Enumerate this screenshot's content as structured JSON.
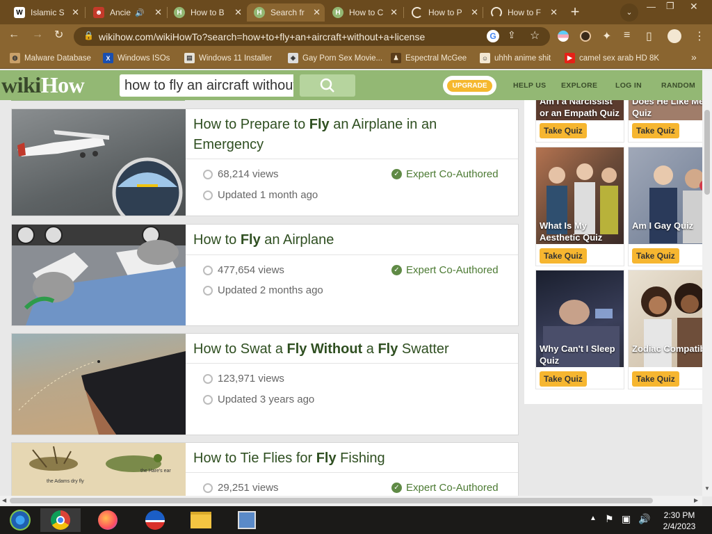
{
  "browser": {
    "tabs": [
      {
        "label": "Islamic S",
        "icon": "wikipedia-icon"
      },
      {
        "label": "Ancie",
        "icon": "mask-icon"
      },
      {
        "label": "How to B",
        "icon": "wikihow-icon"
      },
      {
        "label": "Search fr",
        "icon": "wikihow-icon"
      },
      {
        "label": "How to C",
        "icon": "wikihow-icon"
      },
      {
        "label": "How to P",
        "icon": "loading-icon"
      },
      {
        "label": "How to F",
        "icon": "loading-icon"
      }
    ],
    "url": "wikihow.com/wikiHowTo?search=how+to+fly+an+aircraft+without+a+license",
    "bookmarks": [
      {
        "label": "Malware Database"
      },
      {
        "label": "Windows ISOs"
      },
      {
        "label": "Windows 11 Installer"
      },
      {
        "label": "Gay Porn Sex Movie..."
      },
      {
        "label": "Espectral McGee"
      },
      {
        "label": "uhhh anime shit"
      },
      {
        "label": "camel sex arab HD 8K"
      }
    ]
  },
  "header": {
    "logo_part1": "wiki",
    "logo_part2": "How",
    "search_value": "how to fly an aircraft without a license",
    "upgrade_label": "UPGRADE",
    "nav": [
      "HELP US",
      "EXPLORE",
      "LOG IN",
      "RANDOM"
    ]
  },
  "results": [
    {
      "title_parts": [
        "How to Prepare to ",
        "Fly",
        " an Airplane in an Emergency"
      ],
      "views": "68,214 views",
      "updated": "Updated 1 month ago",
      "expert": "Expert Co-Authored"
    },
    {
      "title_parts": [
        "How to ",
        "Fly",
        " an Airplane"
      ],
      "views": "477,654 views",
      "updated": "Updated 2 months ago",
      "expert": "Expert Co-Authored"
    },
    {
      "title_parts": [
        "How to Swat a ",
        "Fly Without",
        " a ",
        "Fly",
        " Swatter"
      ],
      "views": "123,971 views",
      "updated": "Updated 3 years ago",
      "expert": ""
    },
    {
      "title_parts": [
        "How to Tie Flies for ",
        "Fly",
        " Fishing"
      ],
      "views": "29,251 views",
      "updated": "",
      "expert": "Expert Co-Authored",
      "thumb_captions": [
        "the Adams dry fly",
        "the Hare's ear"
      ]
    }
  ],
  "quizzes": [
    {
      "title": "Am I a Narcissist or an Empath Quiz",
      "button": "Take Quiz"
    },
    {
      "title": "Does He Like Me Quiz",
      "button": "Take Quiz"
    },
    {
      "title": "What Is My Aesthetic Quiz",
      "button": "Take Quiz"
    },
    {
      "title": "Am I Gay Quiz",
      "button": "Take Quiz"
    },
    {
      "title": "Why Can't I Sleep Quiz",
      "button": "Take Quiz"
    },
    {
      "title": "Zodiac Compatibility Quiz",
      "button": "Take Quiz"
    }
  ],
  "taskbar": {
    "time": "2:30 PM",
    "date": "2/4/2023"
  },
  "colors": {
    "brand_green": "#93b874",
    "title_green": "#2f4f21",
    "quiz_button": "#f6b630",
    "browser_frame": "#8a6530"
  }
}
